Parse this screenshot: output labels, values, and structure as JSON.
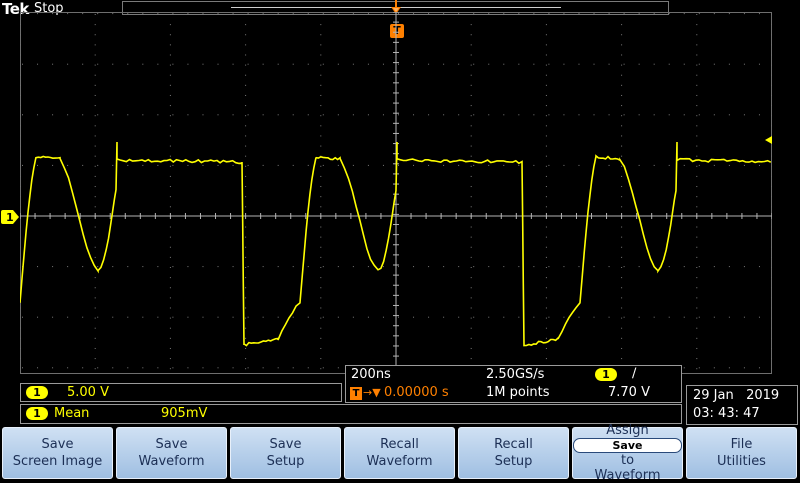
{
  "header": {
    "brand": "Tek",
    "acquisition_state": "Stop"
  },
  "trigger": {
    "position_label": "T"
  },
  "channel1": {
    "marker_label": "1",
    "scale_badge": "1",
    "scale": "5.00 V",
    "waveform_color": "#ffff00"
  },
  "horizontal": {
    "time_per_div": "200ns",
    "sample_rate": "2.50GS/s",
    "trigger_badge": "T",
    "trigger_arrow": "→▼",
    "trigger_delay": "0.00000 s",
    "record_length": "1M points",
    "trigger_channel_badge": "1",
    "trigger_slope": "∕",
    "trigger_level": "7.70 V"
  },
  "measurement": {
    "badge": "1",
    "type": "Mean",
    "value": "905mV"
  },
  "datetime": {
    "date": "29 Jan   2019",
    "time": "03: 43: 47"
  },
  "softkeys": [
    {
      "line1": "Save",
      "line2": "Screen Image"
    },
    {
      "line1": "Save",
      "line2": "Waveform"
    },
    {
      "line1": "Save",
      "line2": "Setup"
    },
    {
      "line1": "Recall",
      "line2": "Waveform"
    },
    {
      "line1": "Recall",
      "line2": "Setup"
    },
    {
      "line1": "Assign",
      "chip": "Save",
      "mid": "to",
      "line2": "Waveform"
    },
    {
      "line1": "File",
      "line2": "Utilities"
    }
  ],
  "colors": {
    "accent": "#ffff00",
    "trigger": "#ff8000",
    "softkey": "#b4cde9"
  }
}
